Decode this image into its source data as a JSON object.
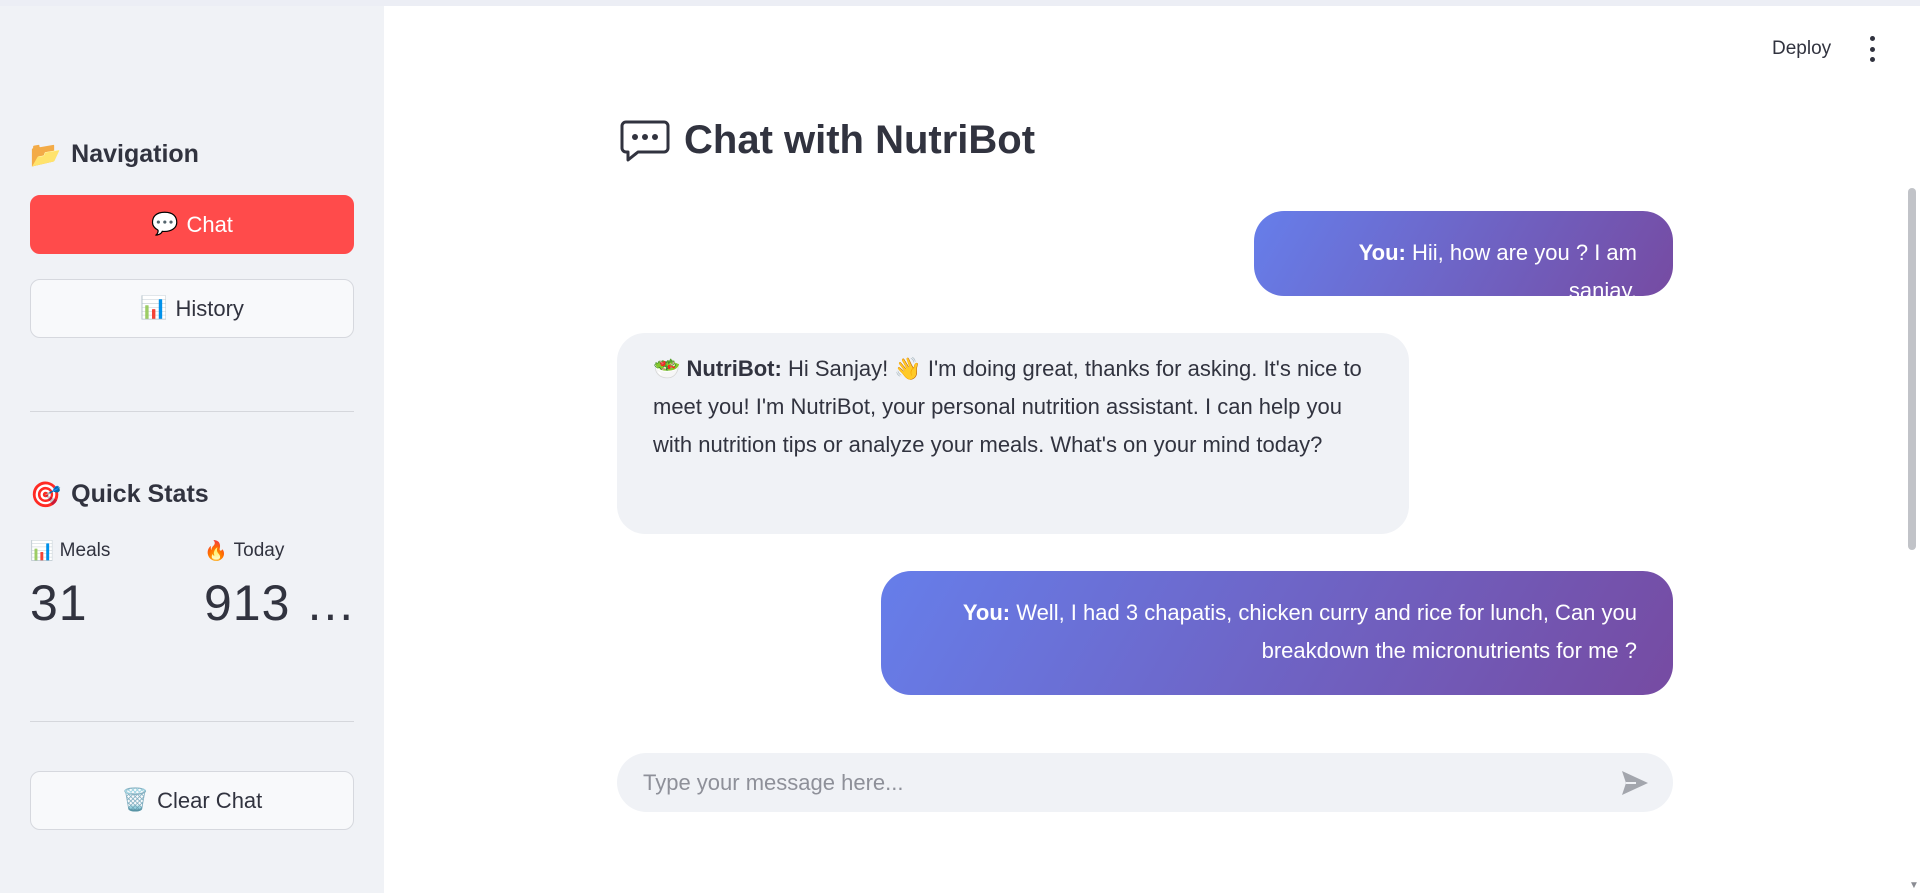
{
  "sidebar": {
    "navigation": {
      "icon": "📂",
      "title": "Navigation"
    },
    "buttons": [
      {
        "icon": "💬",
        "label": "Chat"
      },
      {
        "icon": "📊",
        "label": "History"
      }
    ],
    "quick_stats": {
      "icon": "🎯",
      "title": "Quick Stats",
      "metrics": [
        {
          "icon": "📊",
          "label": "Meals",
          "value": "31"
        },
        {
          "icon": "🔥",
          "label": "Today",
          "value": "913 …"
        }
      ]
    },
    "clear_button": {
      "icon": "🗑️",
      "label": "Clear Chat"
    }
  },
  "header": {
    "deploy_label": "Deploy"
  },
  "main": {
    "title_icon": "💬",
    "title": "Chat with NutriBot",
    "messages": [
      {
        "role": "user",
        "sender": "You:",
        "text": " Hii, how are you ? I am sanjay."
      },
      {
        "role": "bot",
        "icon": "🥗",
        "sender": "NutriBot:",
        "text": " Hi Sanjay! 👋 I'm doing great, thanks for asking. It's nice to meet you! I'm NutriBot, your personal nutrition assistant. I can help you with nutrition tips or analyze your meals. What's on your mind today?"
      },
      {
        "role": "user",
        "sender": "You:",
        "text": " Well, I had 3 chapatis, chicken curry and rice for lunch, Can you breakdown the micronutrients for me ?"
      }
    ],
    "input": {
      "placeholder": "Type your message here...",
      "value": ""
    }
  },
  "colors": {
    "primary_button": "#ff4b4b",
    "user_bubble_start": "#667eea",
    "user_bubble_end": "#764ba2",
    "sidebar_bg": "#f0f2f6"
  },
  "icons": {
    "deploy_menu": "kebab-menu-icon",
    "send": "send-icon"
  }
}
